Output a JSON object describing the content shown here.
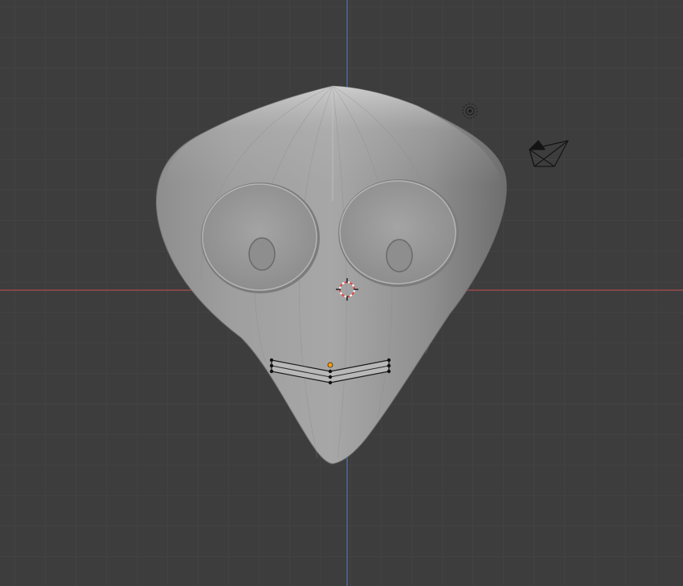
{
  "viewport": {
    "view": "front-orthographic",
    "shading": "solid",
    "colors": {
      "background": "#3d3d3d",
      "grid_minor": "#474747",
      "grid_major": "#525252",
      "x_axis": "#9a4a4a",
      "z_axis": "#4d6a99",
      "mesh_base": "#9c9c9c",
      "selection_vertex": "#111111",
      "origin_dot": "#ff9e1a",
      "cursor": "#e04848"
    },
    "objects": [
      {
        "name": "head-mesh",
        "kind": "mesh"
      },
      {
        "name": "left-eye",
        "kind": "mesh"
      },
      {
        "name": "right-eye",
        "kind": "mesh"
      },
      {
        "name": "mouth",
        "kind": "mesh",
        "state": "edit-mode-selected"
      }
    ],
    "gizmos": [
      "3d-cursor-icon",
      "light-icon",
      "camera-icon"
    ]
  }
}
